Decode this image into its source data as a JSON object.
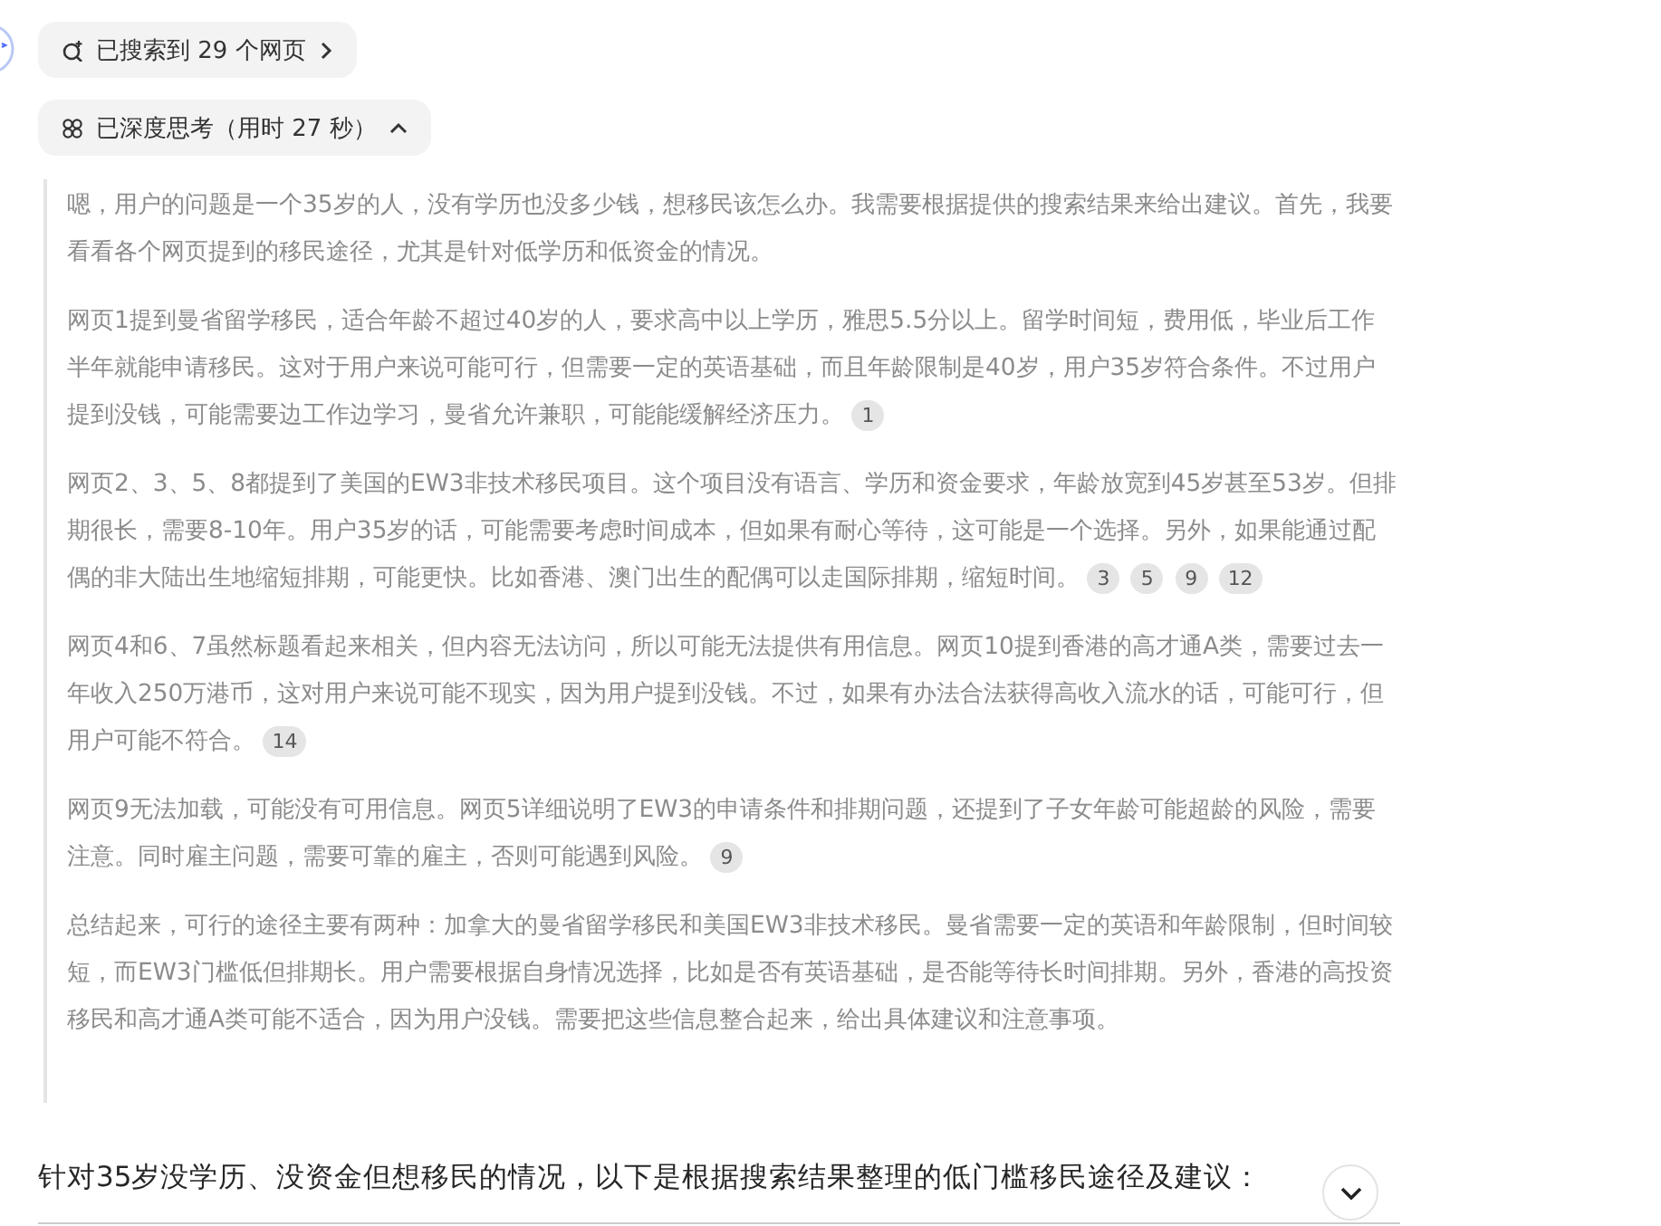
{
  "search_summary": {
    "label": "已搜索到 29 个网页"
  },
  "thinking": {
    "label": "已深度思考（用时 27 秒）",
    "expanded": true,
    "paragraphs": [
      {
        "text": "嗯，用户的问题是一个35岁的人，没有学历也没多少钱，想移民该怎么办。我需要根据提供的搜索结果来给出建议。首先，我要看看各个网页提到的移民途径，尤其是针对低学历和低资金的情况。"
      },
      {
        "text": "网页1提到曼省留学移民，适合年龄不超过40岁的人，要求高中以上学历，雅思5.5分以上。留学时间短，费用低，毕业后工作半年就能申请移民。这对于用户来说可能可行，但需要一定的英语基础，而且年龄限制是40岁，用户35岁符合条件。不过用户提到没钱，可能需要边工作边学习，曼省允许兼职，可能能缓解经济压力。",
        "citations": [
          "1"
        ]
      },
      {
        "text": "网页2、3、5、8都提到了美国的EW3非技术移民项目。这个项目没有语言、学历和资金要求，年龄放宽到45岁甚至53岁。但排期很长，需要8-10年。用户35岁的话，可能需要考虑时间成本，但如果有耐心等待，这可能是一个选择。另外，如果能通过配偶的非大陆出生地缩短排期，可能更快。比如香港、澳门出生的配偶可以走国际排期，缩短时间。",
        "citations": [
          "3",
          "5",
          "9",
          "12"
        ]
      },
      {
        "text": "网页4和6、7虽然标题看起来相关，但内容无法访问，所以可能无法提供有用信息。网页10提到香港的高才通A类，需要过去一年收入250万港币，这对用户来说可能不现实，因为用户提到没钱。不过，如果有办法合法获得高收入流水的话，可能可行，但用户可能不符合。",
        "citations": [
          "14"
        ]
      },
      {
        "text": "网页9无法加载，可能没有可用信息。网页5详细说明了EW3的申请条件和排期问题，还提到了子女年龄可能超龄的风险，需要注意。同时雇主问题，需要可靠的雇主，否则可能遇到风险。",
        "citations": [
          "9"
        ]
      },
      {
        "text": "总结起来，可行的途径主要有两种：加拿大的曼省留学移民和美国EW3非技术移民。曼省需要一定的英语和年龄限制，但时间较短，而EW3门槛低但排期长。用户需要根据自身情况选择，比如是否有英语基础，是否能等待长时间排期。另外，香港的高投资移民和高才通A类可能不适合，因为用户没钱。需要把这些信息整合起来，给出具体建议和注意事项。"
      }
    ]
  },
  "answer": {
    "intro": "针对35岁没学历、没资金但想移民的情况，以下是根据搜索结果整理的低门槛移民途径及建议："
  }
}
